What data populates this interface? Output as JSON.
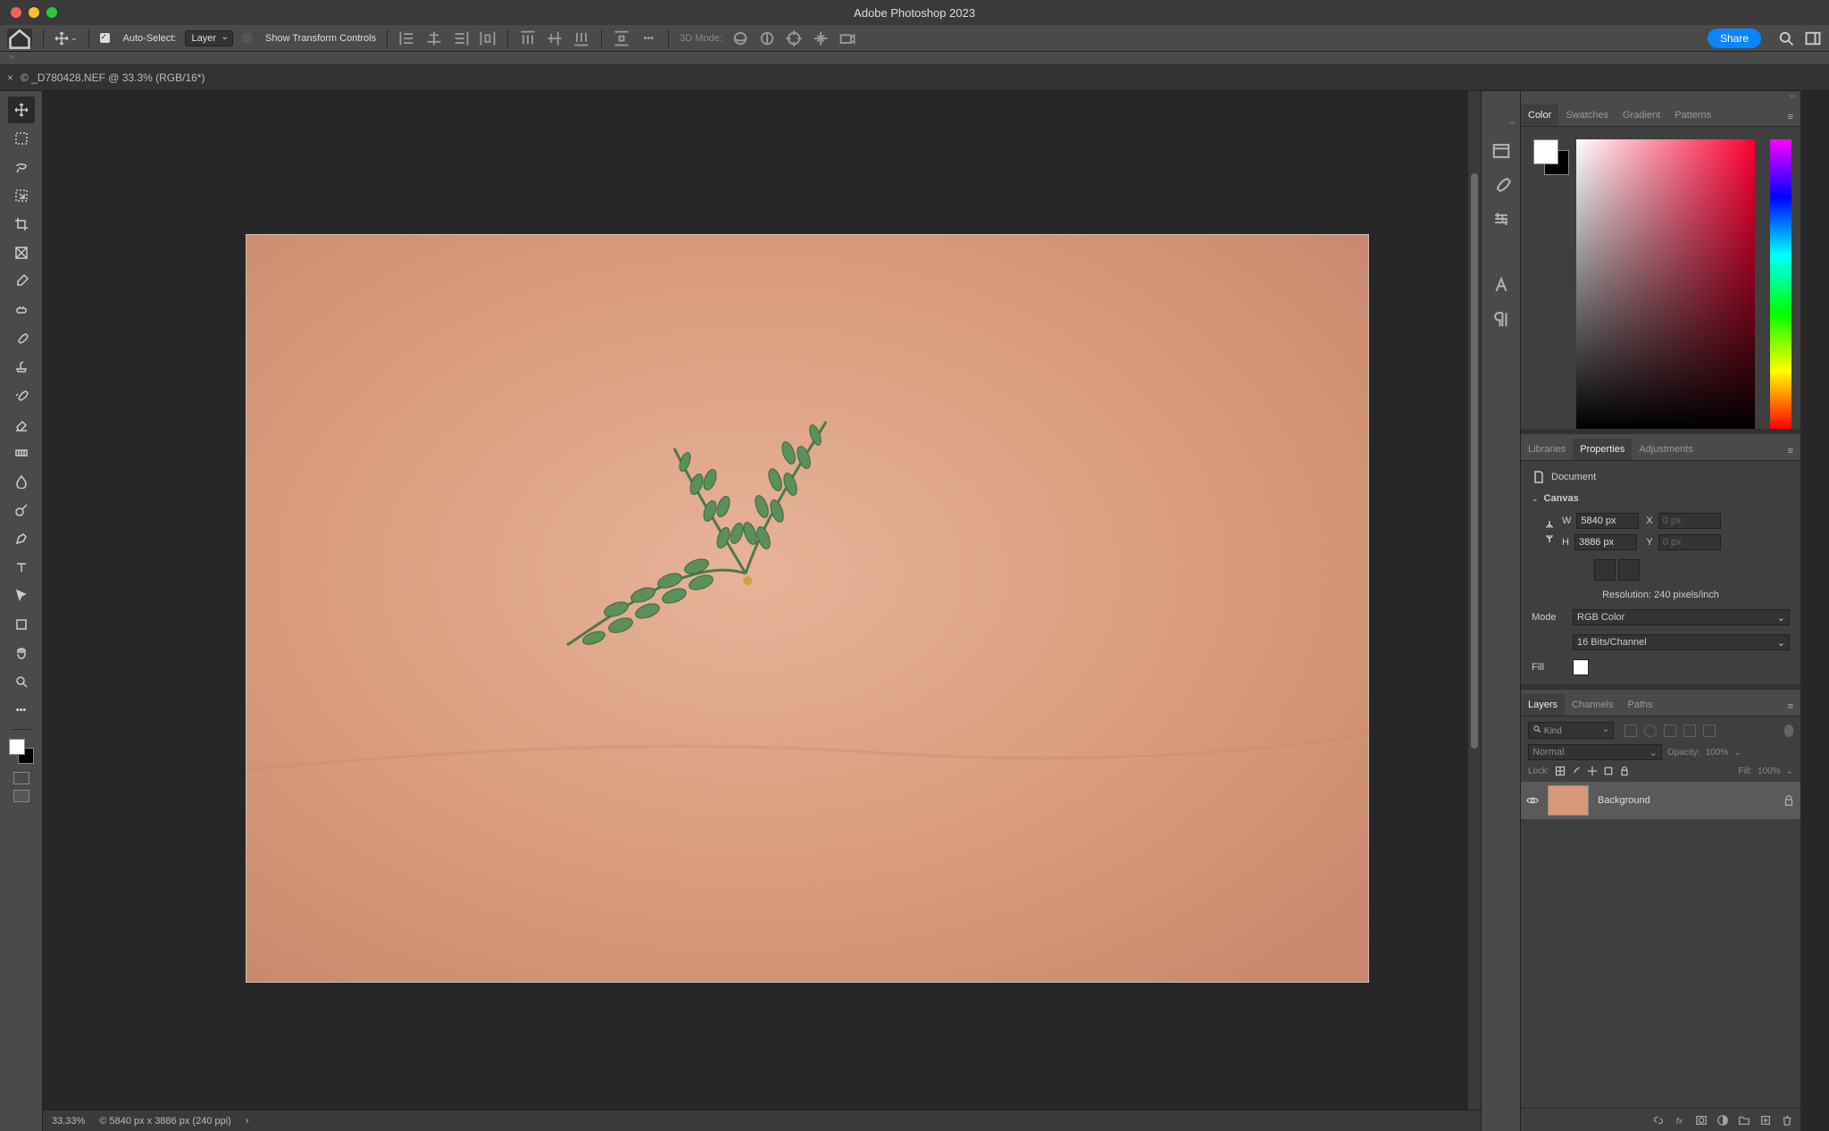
{
  "app_title": "Adobe Photoshop 2023",
  "traffic_colors": {
    "close": "#ff5f57",
    "min": "#febc2e",
    "max": "#28c840"
  },
  "options_bar": {
    "auto_select_label": "Auto-Select:",
    "auto_select_target": "Layer",
    "show_transform_label": "Show Transform Controls",
    "mode_3d_label": "3D Mode:",
    "share_label": "Share"
  },
  "document": {
    "tab_label": "© _D780428.NEF @ 33.3% (RGB/16*)",
    "zoom": "33.33%",
    "dims": "© 5840 px x 3886 px (240 ppi)"
  },
  "color_panel": {
    "tabs": [
      "Color",
      "Swatches",
      "Gradient",
      "Patterns"
    ],
    "active": 0
  },
  "properties_panel": {
    "tabs": [
      "Libraries",
      "Properties",
      "Adjustments"
    ],
    "active": 1,
    "document_label": "Document",
    "canvas_label": "Canvas",
    "w_label": "W",
    "w_value": "5840 px",
    "h_label": "H",
    "h_value": "3886 px",
    "x_label": "X",
    "x_value": "0 px",
    "y_label": "Y",
    "y_value": "0 px",
    "resolution_label": "Resolution: 240 pixels/inch",
    "mode_label": "Mode",
    "mode_value": "RGB Color",
    "depth_value": "16 Bits/Channel",
    "fill_label": "Fill"
  },
  "layers_panel": {
    "tabs": [
      "Layers",
      "Channels",
      "Paths"
    ],
    "active": 0,
    "kind_placeholder": "Kind",
    "blend_mode": "Normal",
    "opacity_label": "Opacity:",
    "opacity_value": "100%",
    "lock_label": "Lock:",
    "fill_label": "Fill:",
    "fill_value": "100%",
    "layer_name": "Background"
  }
}
